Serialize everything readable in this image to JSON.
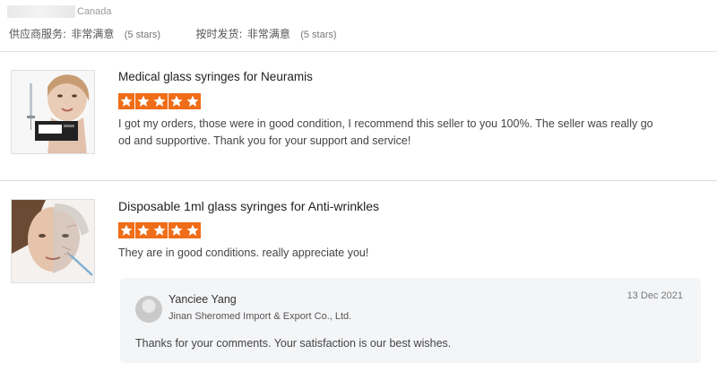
{
  "header": {
    "country": "Canada",
    "ratings": [
      {
        "label": "供应商服务:",
        "value": "非常满意",
        "count": "(5 stars)"
      },
      {
        "label": "按时发货:",
        "value": "非常满意",
        "count": "(5 stars)"
      }
    ]
  },
  "reviews": [
    {
      "title": "Medical glass syringes for Neuramis",
      "stars": 5,
      "text_line1": "I got my orders, those were in good condition, I recommend this seller to you 100%. The seller was really go",
      "text_line2": "od and supportive. Thank you for your support and service!"
    },
    {
      "title": "Disposable 1ml glass syringes for Anti-wrinkles",
      "stars": 5,
      "text_line1": "They are in good conditions. really appreciate you!",
      "reply": {
        "name": "Yanciee Yang",
        "company": "Jinan Sheromed Import & Export Co., Ltd.",
        "date": "13 Dec 2021",
        "text": "Thanks for your comments. Your satisfaction is our best wishes."
      }
    }
  ],
  "colors": {
    "star": "#f06d18",
    "divider": "#dcdcdc",
    "reply_bg": "#f4f5f7"
  }
}
